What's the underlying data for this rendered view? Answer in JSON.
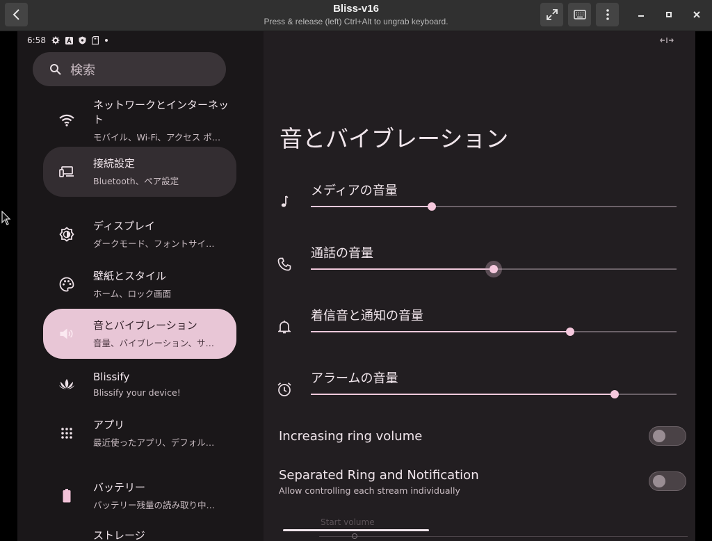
{
  "window": {
    "title": "Bliss-v16",
    "subtitle": "Press & release (left) Ctrl+Alt to ungrab keyboard."
  },
  "statusbar": {
    "time": "6:58"
  },
  "search": {
    "placeholder": "検索"
  },
  "sidebar": {
    "items": [
      {
        "title": "ネットワークとインターネット",
        "subtitle": "モバイル、Wi-Fi、アクセス ポ…",
        "icon": "wifi-icon"
      },
      {
        "title": "接続設定",
        "subtitle": "Bluetooth、ペア設定",
        "icon": "devices-icon"
      },
      {
        "title": "ディスプレイ",
        "subtitle": "ダークモード、フォントサイ…",
        "icon": "brightness-icon"
      },
      {
        "title": "壁紙とスタイル",
        "subtitle": "ホーム、ロック画面",
        "icon": "palette-icon"
      },
      {
        "title": "音とバイブレーション",
        "subtitle": "音量、バイブレーション、サ…",
        "icon": "volume-icon"
      },
      {
        "title": "Blissify",
        "subtitle": "Blissify your device!",
        "icon": "lotus-icon"
      },
      {
        "title": "アプリ",
        "subtitle": "最近使ったアプリ、デフォル…",
        "icon": "apps-grid-icon"
      },
      {
        "title": "バッテリー",
        "subtitle": "バッテリー残量の読み取り中…",
        "icon": "battery-icon"
      },
      {
        "title": "ストレージ",
        "subtitle": "",
        "icon": "storage-icon"
      }
    ]
  },
  "main": {
    "title": "音とバイブレーション",
    "volumes": [
      {
        "label": "メディアの音量",
        "icon": "music-note-icon",
        "level": 0.33
      },
      {
        "label": "通話の音量",
        "icon": "phone-icon",
        "level": 0.5
      },
      {
        "label": "着信音と通知の音量",
        "icon": "bell-icon",
        "level": 0.71
      },
      {
        "label": "アラームの音量",
        "icon": "alarm-icon",
        "level": 0.83
      }
    ],
    "toggles": [
      {
        "title": "Increasing ring volume",
        "subtitle": "",
        "on": false
      },
      {
        "title": "Separated Ring and Notification",
        "subtitle": "Allow controlling each stream individually",
        "on": false
      }
    ],
    "start_volume_label": "Start volume"
  },
  "colors": {
    "accent": "#e8c6d6",
    "background": "#1a1719",
    "panel": "#221e21"
  }
}
